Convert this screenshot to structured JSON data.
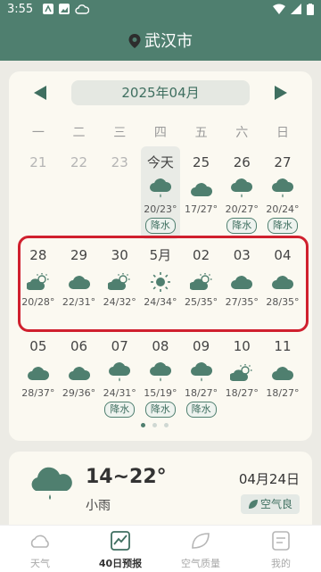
{
  "status": {
    "time": "3:55"
  },
  "header": {
    "city": "武汉市"
  },
  "calendar": {
    "month": "2025年04月",
    "weekdays": [
      "一",
      "二",
      "三",
      "四",
      "五",
      "六",
      "日"
    ],
    "rows": [
      [
        {
          "date": "21",
          "muted": true
        },
        {
          "date": "22",
          "muted": true
        },
        {
          "date": "23",
          "muted": true
        },
        {
          "date": "今天",
          "icon": "rain-icon",
          "temp": "20/23°",
          "badge": "降水"
        },
        {
          "date": "25",
          "icon": "cloud-icon",
          "temp": "17/27°"
        },
        {
          "date": "26",
          "icon": "rain-icon",
          "temp": "20/27°",
          "badge": "降水"
        },
        {
          "date": "27",
          "icon": "rain-icon",
          "temp": "20/24°",
          "badge": "降水"
        }
      ],
      [
        {
          "date": "28",
          "icon": "partly-cloudy-icon",
          "temp": "20/28°"
        },
        {
          "date": "29",
          "icon": "cloud-icon",
          "temp": "22/31°"
        },
        {
          "date": "30",
          "icon": "partly-cloudy-icon",
          "temp": "24/32°"
        },
        {
          "date": "5月",
          "icon": "sun-icon",
          "temp": "24/34°"
        },
        {
          "date": "02",
          "icon": "partly-cloudy-icon",
          "temp": "25/35°"
        },
        {
          "date": "03",
          "icon": "cloud-icon",
          "temp": "27/35°"
        },
        {
          "date": "04",
          "icon": "cloud-icon",
          "temp": "28/35°"
        }
      ],
      [
        {
          "date": "05",
          "icon": "cloud-icon",
          "temp": "28/37°"
        },
        {
          "date": "06",
          "icon": "cloud-icon",
          "temp": "29/36°"
        },
        {
          "date": "07",
          "icon": "rain-icon",
          "temp": "24/31°",
          "badge": "降水"
        },
        {
          "date": "08",
          "icon": "rain-icon",
          "temp": "15/19°",
          "badge": "降水"
        },
        {
          "date": "09",
          "icon": "rain-icon",
          "temp": "18/27°",
          "badge": "降水"
        },
        {
          "date": "10",
          "icon": "partly-cloudy-icon",
          "temp": "18/27°"
        },
        {
          "date": "11",
          "icon": "cloud-icon",
          "temp": "18/27°"
        }
      ]
    ]
  },
  "today": {
    "range": "14~22°",
    "desc": "小雨",
    "date": "04月24日",
    "aqi": "空气良"
  },
  "nav": [
    {
      "label": "天气",
      "icon": "weather-icon",
      "active": false
    },
    {
      "label": "40日预报",
      "icon": "chart-icon",
      "active": true
    },
    {
      "label": "空气质量",
      "icon": "leaf-icon",
      "active": false
    },
    {
      "label": "我的",
      "icon": "profile-icon",
      "active": false
    }
  ],
  "colors": {
    "accent": "#4f7f6f",
    "highlight": "#d0202e"
  }
}
